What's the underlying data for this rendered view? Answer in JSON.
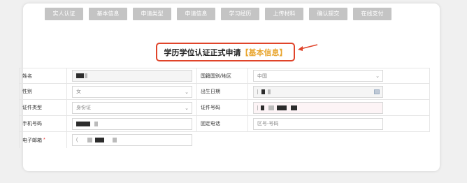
{
  "steps": [
    "实人认证",
    "基本信息",
    "申请类型",
    "申请信息",
    "学习经历",
    "上传材料",
    "确认提交",
    "在线支付"
  ],
  "title": {
    "main": "学历学位认证正式申请",
    "highlight": "【基本信息】"
  },
  "colors": {
    "accent_red": "#e0442a",
    "highlight_orange": "#e8a52e",
    "step_gray": "#c4c4c4"
  },
  "form": {
    "name_label": "姓名",
    "country_label": "国籍国别/地区",
    "country_value": "中国",
    "gender_label": "性别",
    "gender_value": "女",
    "birth_label": "出生日期",
    "id_type_label": "证件类型",
    "id_type_value": "身份证",
    "id_no_label": "证件号码",
    "phone_label": "手机号码",
    "landline_label": "固定电话",
    "landline_placeholder": "区号-号码",
    "email_label": "电子邮箱",
    "email_required": "*",
    "email_value": "("
  }
}
